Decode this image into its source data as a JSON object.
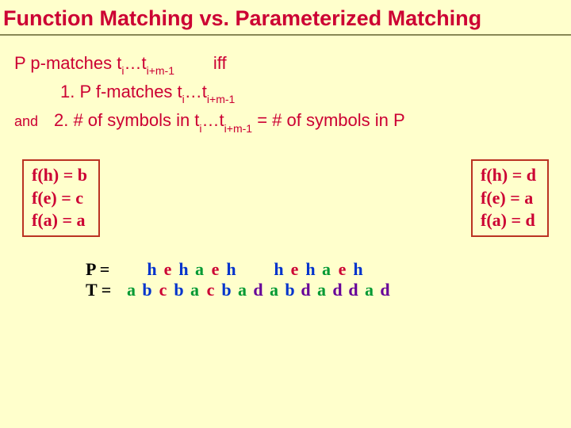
{
  "title": "Function Matching  vs. Parameterized Matching",
  "statement": {
    "line1_pre": "P  p-matches  t",
    "line1_sub1": "i",
    "line1_mid": "…t",
    "line1_sub2": "i+m-1",
    "line1_post": "        iff",
    "line2_pre": "1. P  f-matches  t",
    "line2_sub1": "i",
    "line2_mid": "…t",
    "line2_sub2": "i+m-1",
    "and": "and",
    "line3_pre": "2. # of symbols in t",
    "line3_sub1": "i",
    "line3_mid": "…t",
    "line3_sub2": "i+m-1",
    "line3_post": " = # of symbols in P"
  },
  "leftBox": {
    "l1": "f(h) = b",
    "l2": "f(e) = c",
    "l3": "f(a) = a"
  },
  "rightBox": {
    "l1": "f(h) = d",
    "l2": "f(e) = a",
    "l3": "f(a) = d"
  },
  "bottom": {
    "P_label": "P =",
    "T_label": "T =",
    "P_seq": [
      {
        "t": "h",
        "c": "blue"
      },
      {
        "t": "e",
        "c": "red"
      },
      {
        "t": "h",
        "c": "blue"
      },
      {
        "t": "a",
        "c": "green"
      },
      {
        "t": "e",
        "c": "red"
      },
      {
        "t": "h",
        "c": "blue"
      },
      {
        "t": "",
        "c": "gap"
      },
      {
        "t": "h",
        "c": "blue"
      },
      {
        "t": "e",
        "c": "red"
      },
      {
        "t": "h",
        "c": "blue"
      },
      {
        "t": "a",
        "c": "green"
      },
      {
        "t": "e",
        "c": "red"
      },
      {
        "t": "h",
        "c": "blue"
      }
    ],
    "T_seq": [
      {
        "t": "a",
        "c": "green"
      },
      {
        "t": "b",
        "c": "blue"
      },
      {
        "t": "c",
        "c": "red"
      },
      {
        "t": "b",
        "c": "blue"
      },
      {
        "t": "a",
        "c": "green"
      },
      {
        "t": "c",
        "c": "red"
      },
      {
        "t": "b",
        "c": "blue"
      },
      {
        "t": "a",
        "c": "green"
      },
      {
        "t": "d",
        "c": "purple"
      },
      {
        "t": "a",
        "c": "green"
      },
      {
        "t": "b",
        "c": "blue"
      },
      {
        "t": "d",
        "c": "purple"
      },
      {
        "t": "a",
        "c": "green"
      },
      {
        "t": "d",
        "c": "purple"
      },
      {
        "t": "d",
        "c": "purple"
      },
      {
        "t": "a",
        "c": "green"
      },
      {
        "t": "d",
        "c": "purple"
      }
    ]
  }
}
